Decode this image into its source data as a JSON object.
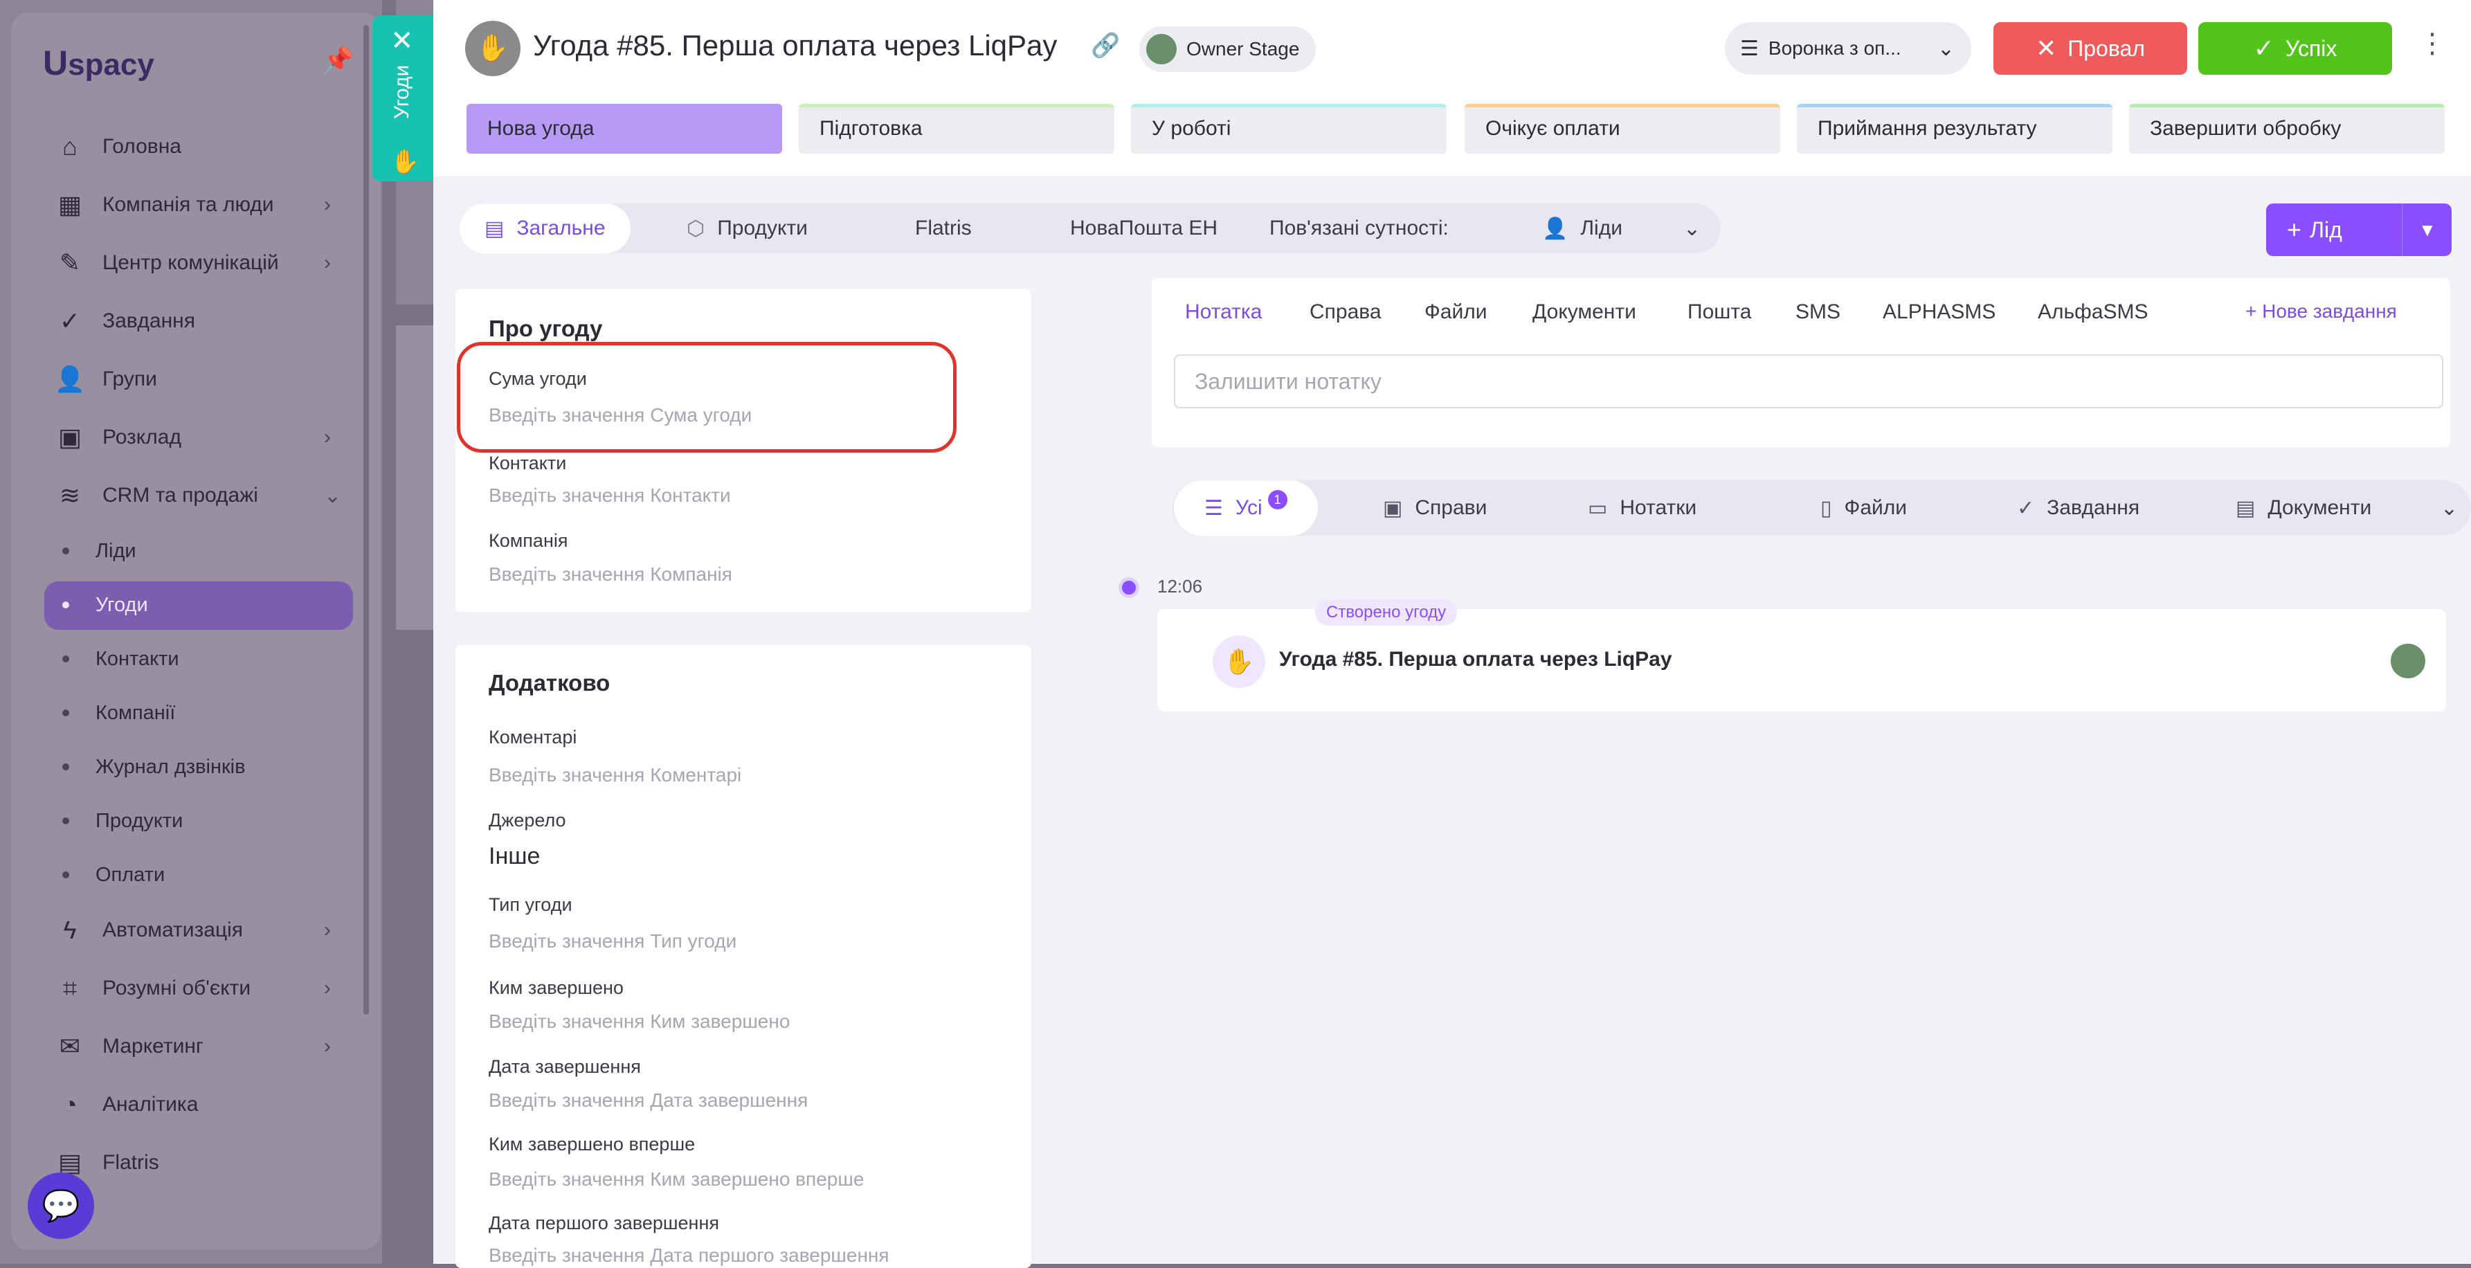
{
  "sidebar": {
    "logo": "spacy",
    "logo_letter": "U",
    "items": [
      {
        "label": "Головна",
        "icon": "home-icon",
        "chevron": false
      },
      {
        "label": "Компанія та люди",
        "icon": "building-icon",
        "chevron": true
      },
      {
        "label": "Центр комунікацій",
        "icon": "chat-edit-icon",
        "chevron": true
      },
      {
        "label": "Завдання",
        "icon": "check-circle-icon",
        "chevron": false
      },
      {
        "label": "Групи",
        "icon": "user-group-icon",
        "chevron": false
      },
      {
        "label": "Розклад",
        "icon": "calendar-icon",
        "chevron": true
      },
      {
        "label": "CRM та продажі",
        "icon": "database-icon",
        "chevron": true
      },
      {
        "label": "Автоматизація",
        "icon": "lightning-icon",
        "chevron": true
      },
      {
        "label": "Розумні об'єкти",
        "icon": "smart-object-icon",
        "chevron": true
      },
      {
        "label": "Маркетинг",
        "icon": "megaphone-icon",
        "chevron": true
      },
      {
        "label": "Аналітика",
        "icon": "analytics-icon",
        "chevron": false
      },
      {
        "label": "Flatris",
        "icon": "grid-icon",
        "chevron": false
      }
    ],
    "sub_items": [
      "Ліди",
      "Угоди",
      "Контакти",
      "Компанії",
      "Журнал дзвінків",
      "Продукти",
      "Оплати"
    ],
    "active_sub": "Угоди"
  },
  "side_tab": {
    "label": "Угоди"
  },
  "header": {
    "title": "Угода #85. Перша оплата через LiqPay",
    "owner": "Owner Stage",
    "funnel": "Воронка з оп...",
    "fail_label": "Провал",
    "success_label": "Успіх"
  },
  "stages": [
    {
      "label": "Нова угода",
      "color": "#b69af5",
      "active": true
    },
    {
      "label": "Підготовка",
      "color": "#c9f0b8",
      "active": false
    },
    {
      "label": "У роботі",
      "color": "#b5ecec",
      "active": false
    },
    {
      "label": "Очікує оплати",
      "color": "#f7cf96",
      "active": false
    },
    {
      "label": "Приймання результату",
      "color": "#a9d3f5",
      "active": false
    },
    {
      "label": "Завершити обробку",
      "color": "#b8ecb0",
      "active": false
    }
  ],
  "tabs": {
    "general": "Загальне",
    "products": "Продукти",
    "flatris": "Flatris",
    "novaposhta": "НоваПошта ЕН",
    "related": "Пов'язані сутності:",
    "leads": "Ліди"
  },
  "lead_button": "Лід",
  "about": {
    "title": "Про угоду",
    "fields": [
      {
        "label": "Сума угоди",
        "value": "Введіть значення Сума угоди"
      },
      {
        "label": "Контакти",
        "value": "Введіть значення Контакти"
      },
      {
        "label": "Компанія",
        "value": "Введіть значення Компанія"
      }
    ]
  },
  "additional": {
    "title": "Додатково",
    "fields": [
      {
        "label": "Коментарі",
        "value": "Введіть значення Коментарі"
      },
      {
        "label": "Джерело",
        "value": "Інше"
      },
      {
        "label": "Тип угоди",
        "value": "Введіть значення Тип угоди"
      },
      {
        "label": "Ким завершено",
        "value": "Введіть значення Ким завершено"
      },
      {
        "label": "Дата завершення",
        "value": "Введіть значення Дата завершення"
      },
      {
        "label": "Ким завершено вперше",
        "value": "Введіть значення Ким завершено вперше"
      },
      {
        "label": "Дата першого завершення",
        "value": "Введіть значення Дата першого завершення"
      }
    ]
  },
  "activity": {
    "tabs": [
      "Нотатка",
      "Справа",
      "Файли",
      "Документи",
      "Пошта",
      "SMS",
      "ALPHASMS",
      "АльфаSMS"
    ],
    "new_task": "Нове завдання",
    "note_placeholder": "Залишити нотатку"
  },
  "filters": {
    "all": "Усі",
    "all_count": "1",
    "deals": "Справи",
    "notes": "Нотатки",
    "files": "Файли",
    "tasks": "Завдання",
    "docs": "Документи"
  },
  "timeline": {
    "time": "12:06",
    "tag": "Створено угоду",
    "title": "Угода #85. Перша оплата через LiqPay"
  }
}
